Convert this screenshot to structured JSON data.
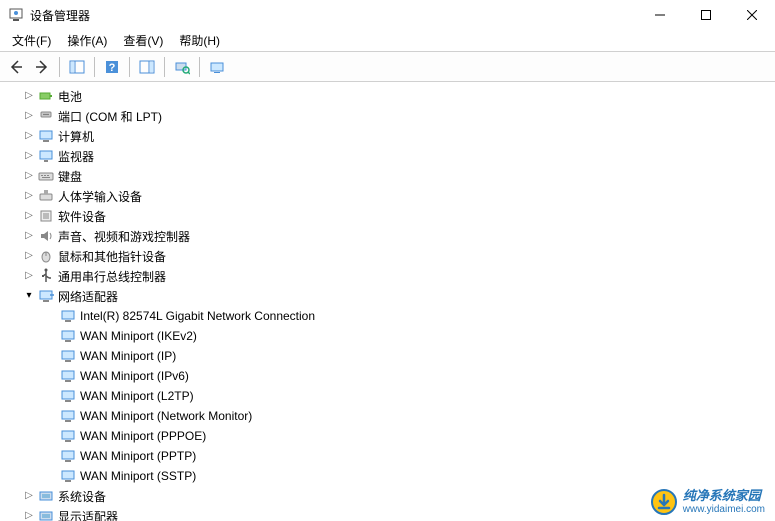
{
  "window": {
    "title": "设备管理器"
  },
  "menu": {
    "file": "文件(F)",
    "action": "操作(A)",
    "view": "查看(V)",
    "help": "帮助(H)"
  },
  "tree": {
    "battery": "电池",
    "ports": "端口 (COM 和 LPT)",
    "computer": "计算机",
    "monitors": "监视器",
    "keyboards": "键盘",
    "hid": "人体学输入设备",
    "software_devices": "软件设备",
    "sound": "声音、视频和游戏控制器",
    "mice": "鼠标和其他指针设备",
    "usb": "通用串行总线控制器",
    "network_adapters": "网络适配器",
    "net": {
      "intel": "Intel(R) 82574L Gigabit Network Connection",
      "wan_ikev2": "WAN Miniport (IKEv2)",
      "wan_ip": "WAN Miniport (IP)",
      "wan_ipv6": "WAN Miniport (IPv6)",
      "wan_l2tp": "WAN Miniport (L2TP)",
      "wan_netmon": "WAN Miniport (Network Monitor)",
      "wan_pppoe": "WAN Miniport (PPPOE)",
      "wan_pptp": "WAN Miniport (PPTP)",
      "wan_sstp": "WAN Miniport (SSTP)"
    },
    "system_devices": "系统设备",
    "display_adapters": "显示适配器"
  },
  "watermark": {
    "title": "纯净系统家园",
    "url": "www.yidaimei.com"
  }
}
